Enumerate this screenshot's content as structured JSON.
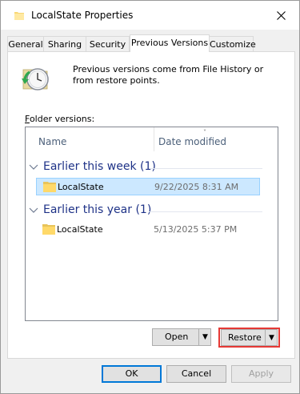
{
  "window": {
    "title": "LocalState Properties",
    "icon": "folder-icon",
    "close_icon": "close-icon"
  },
  "tabs": [
    {
      "label": "General",
      "active": false
    },
    {
      "label": "Sharing",
      "active": false
    },
    {
      "label": "Security",
      "active": false
    },
    {
      "label": "Previous Versions",
      "active": true
    },
    {
      "label": "Customize",
      "active": false
    }
  ],
  "info": {
    "icon": "clock-icon",
    "text": "Previous versions come from File History or from restore points."
  },
  "folder_versions_label": "Folder versions:",
  "list": {
    "columns": {
      "name": "Name",
      "date": "Date modified"
    },
    "groups": [
      {
        "label": "Earlier this week (1)",
        "items": [
          {
            "name": "LocalState",
            "date": "9/22/2025 8:31 AM",
            "selected": true
          }
        ]
      },
      {
        "label": "Earlier this year (1)",
        "items": [
          {
            "name": "LocalState",
            "date": "5/13/2025 5:37 PM",
            "selected": false
          }
        ]
      }
    ]
  },
  "buttons": {
    "open": "Open",
    "restore": "Restore",
    "ok": "OK",
    "cancel": "Cancel",
    "apply": "Apply"
  },
  "colors": {
    "accent": "#0078d7",
    "highlight": "#e53935",
    "selection": "#cce8ff"
  }
}
